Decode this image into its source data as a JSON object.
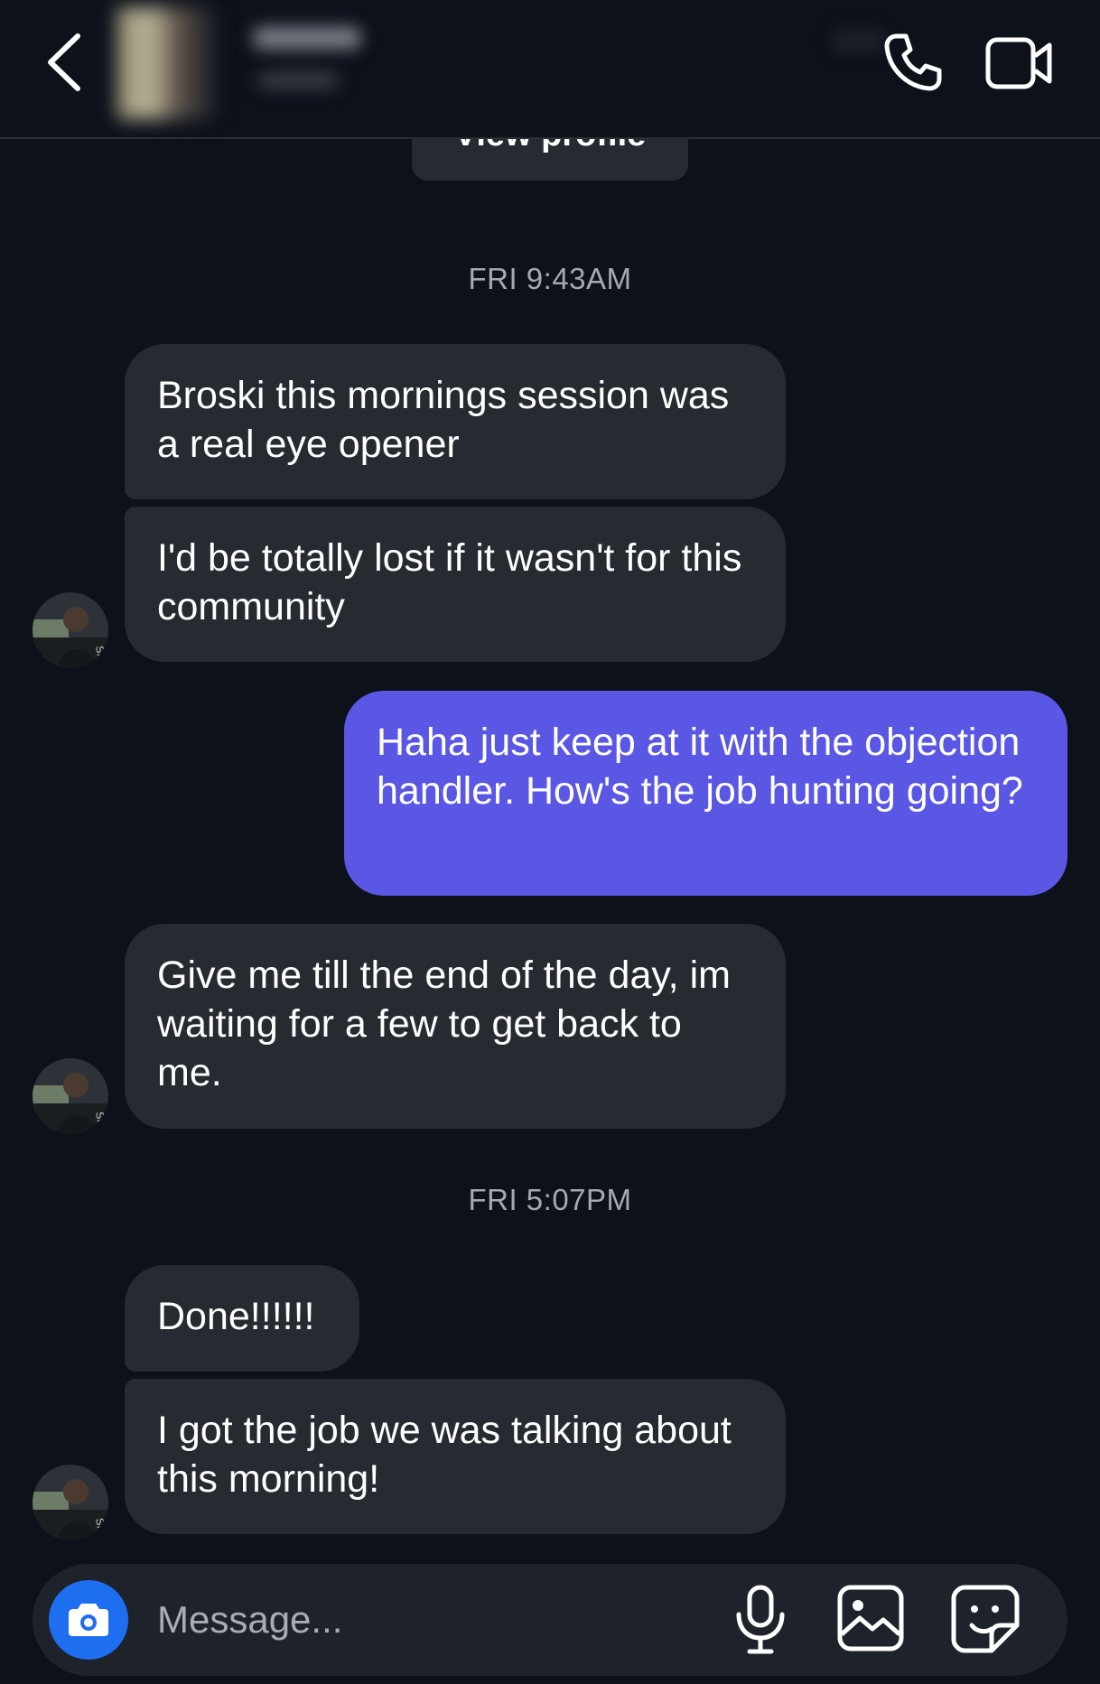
{
  "header": {
    "back_icon": "chevron-left-icon",
    "call_icon": "phone-icon",
    "video_icon": "video-camera-icon"
  },
  "profile": {
    "view_profile_label": "View profile"
  },
  "thread": {
    "timestamps": [
      "FRI 9:43AM",
      "FRI 5:07PM"
    ],
    "messages": [
      {
        "from": "them",
        "text": "Broski this mornings session was a real eye opener"
      },
      {
        "from": "them",
        "text": "I'd be totally lost if it wasn't for this community"
      },
      {
        "from": "me",
        "text": "Haha just keep at it with the objection handler. How's the job hunting going?"
      },
      {
        "from": "them",
        "text": "Give me till the end of the day, im waiting for a few to get back to me."
      },
      {
        "from": "them",
        "text": "Done!!!!!!"
      },
      {
        "from": "them",
        "text": "I got the job we was talking about this morning!"
      }
    ]
  },
  "composer": {
    "placeholder": "Message...",
    "camera_icon": "camera-icon",
    "mic_icon": "microphone-icon",
    "gallery_icon": "image-icon",
    "sticker_icon": "sticker-icon"
  },
  "colors": {
    "background": "#0c111a",
    "incoming_bubble": "#262a31",
    "outgoing_bubble": "#5b57e5",
    "camera_button": "#1e6ff0",
    "timestamp_text": "#a6a9b0"
  }
}
